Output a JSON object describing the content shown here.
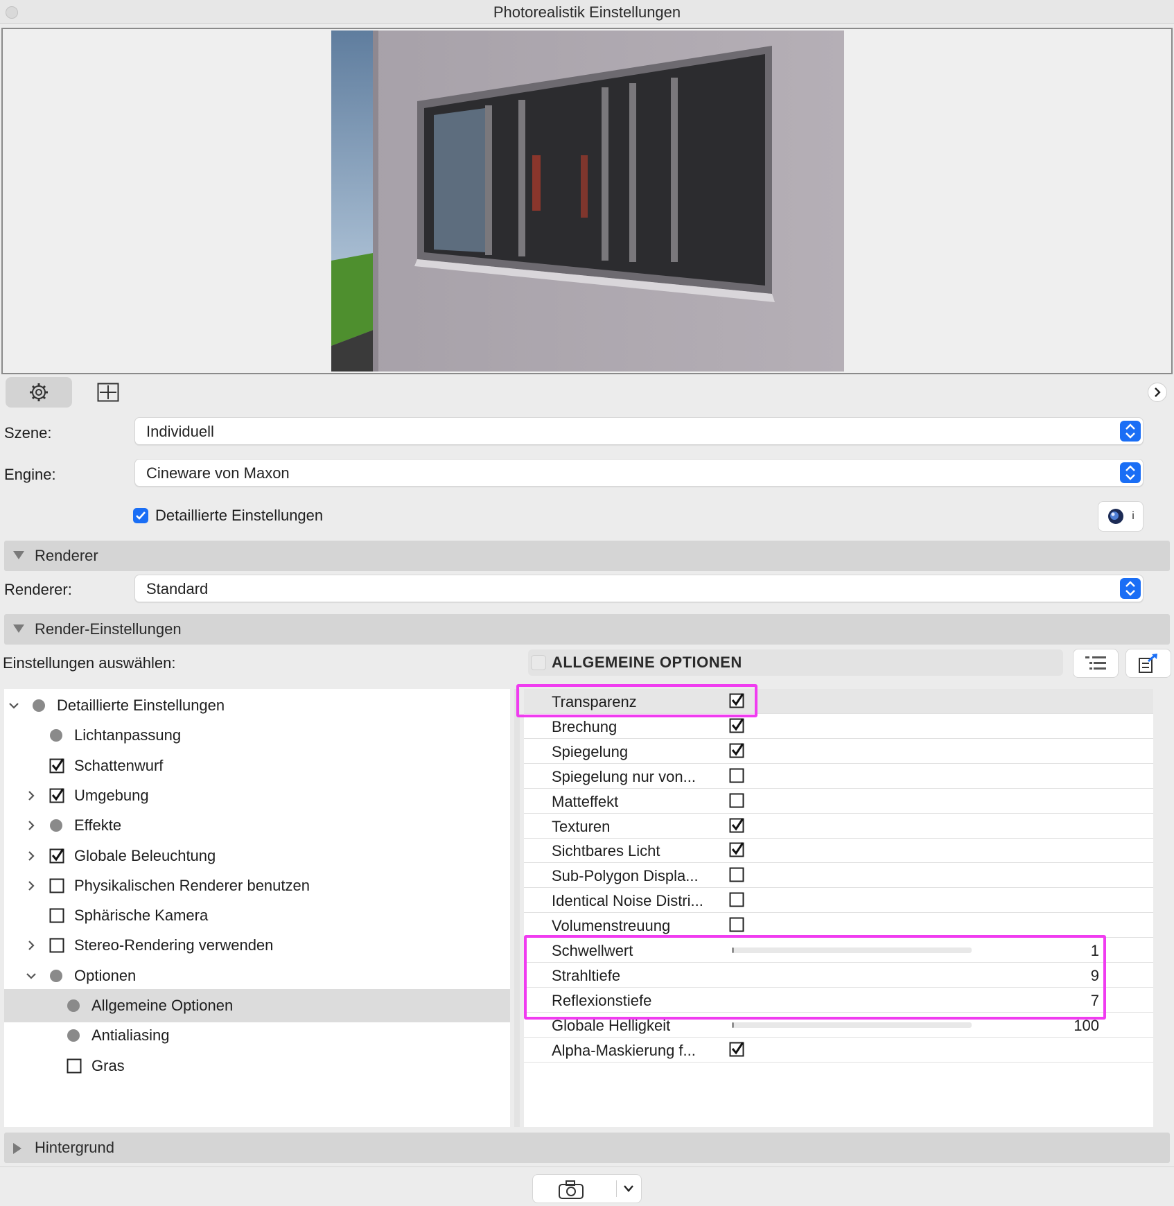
{
  "window": {
    "title": "Photorealistik Einstellungen"
  },
  "toolbar": {
    "icons": [
      "gear-icon",
      "frame-icon",
      "chevron-right-icon"
    ]
  },
  "scene": {
    "label": "Szene:",
    "value": "Individuell"
  },
  "engine": {
    "label": "Engine:",
    "value": "Cineware von Maxon"
  },
  "detailed": {
    "label": "Detaillierte Einstellungen",
    "checked": true
  },
  "sections": {
    "renderer": "Renderer",
    "render_settings": "Render-Einstellungen",
    "background": "Hintergrund"
  },
  "renderer": {
    "label": "Renderer:",
    "value": "Standard"
  },
  "select_settings_label": "Einstellungen auswählen:",
  "tree": [
    {
      "label": "Detaillierte Einstellungen",
      "mark": "disc",
      "expander": "down",
      "level": 0
    },
    {
      "label": "Lichtanpassung",
      "mark": "disc",
      "expander": "none",
      "level": 1
    },
    {
      "label": "Schattenwurf",
      "mark": "checked",
      "expander": "none",
      "level": 1
    },
    {
      "label": "Umgebung",
      "mark": "checked",
      "expander": "right",
      "level": 1
    },
    {
      "label": "Effekte",
      "mark": "disc",
      "expander": "right",
      "level": 1
    },
    {
      "label": "Globale Beleuchtung",
      "mark": "checked",
      "expander": "right",
      "level": 1
    },
    {
      "label": "Physikalischen Renderer benutzen",
      "mark": "unchecked",
      "expander": "right",
      "level": 1
    },
    {
      "label": "Sphärische Kamera",
      "mark": "unchecked",
      "expander": "none",
      "level": 1
    },
    {
      "label": "Stereo-Rendering verwenden",
      "mark": "unchecked",
      "expander": "right",
      "level": 1
    },
    {
      "label": "Optionen",
      "mark": "disc",
      "expander": "down",
      "level": 1
    },
    {
      "label": "Allgemeine Optionen",
      "mark": "disc",
      "expander": "none",
      "level": 2,
      "selected": true
    },
    {
      "label": "Antialiasing",
      "mark": "disc",
      "expander": "none",
      "level": 2
    },
    {
      "label": "Gras",
      "mark": "unchecked",
      "expander": "none",
      "level": 2
    }
  ],
  "options_header": "ALLGEMEINE OPTIONEN",
  "options": [
    {
      "name": "Transparenz",
      "type": "check",
      "checked": true
    },
    {
      "name": "Brechung",
      "type": "check",
      "checked": true
    },
    {
      "name": "Spiegelung",
      "type": "check",
      "checked": true
    },
    {
      "name": "Spiegelung nur von...",
      "type": "check",
      "checked": false
    },
    {
      "name": "Matteffekt",
      "type": "check",
      "checked": false
    },
    {
      "name": "Texturen",
      "type": "check",
      "checked": true
    },
    {
      "name": "Sichtbares Licht",
      "type": "check",
      "checked": true
    },
    {
      "name": "Sub-Polygon Displa...",
      "type": "check",
      "checked": false
    },
    {
      "name": "Identical Noise Distri...",
      "type": "check",
      "checked": false
    },
    {
      "name": "Volumenstreuung",
      "type": "check",
      "checked": false
    },
    {
      "name": "Schwellwert",
      "type": "slider",
      "value": "1",
      "fill": 0.01
    },
    {
      "name": "Strahltiefe",
      "type": "number",
      "value": "9"
    },
    {
      "name": "Reflexionstiefe",
      "type": "number",
      "value": "7"
    },
    {
      "name": "Globale Helligkeit",
      "type": "slider",
      "value": "100",
      "fill": 0.005
    },
    {
      "name": "Alpha-Maskierung f...",
      "type": "check",
      "checked": true
    }
  ],
  "colors": {
    "accent": "#1a6ef5",
    "highlight": "#f03cf0"
  }
}
